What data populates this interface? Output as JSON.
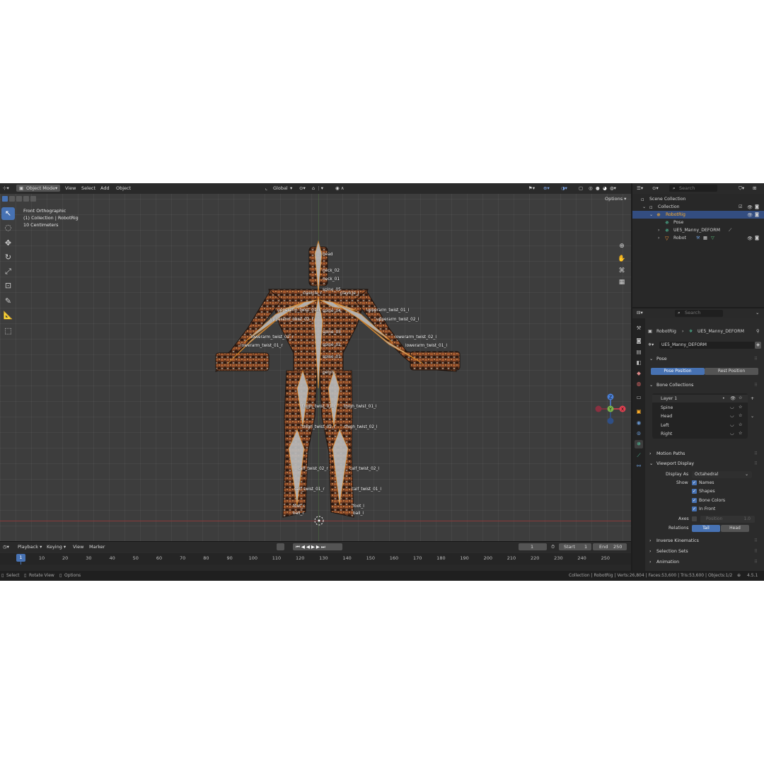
{
  "viewport": {
    "mode": "Object Mode",
    "menus": [
      "View",
      "Select",
      "Add",
      "Object"
    ],
    "transform_orientation": "Global",
    "options_label": "Options",
    "view_name": "Front Orthographic",
    "collection_info": "(1) Collection | RobotRig",
    "scale_info": "10 Centimeters",
    "gizmo_axes": [
      "Z",
      "X",
      "Y"
    ]
  },
  "bones": [
    {
      "name": "head"
    },
    {
      "name": "neck_02"
    },
    {
      "name": "neck_01"
    },
    {
      "name": "spine_05"
    },
    {
      "name": "clavicle_r"
    },
    {
      "name": "clavicle_l"
    },
    {
      "name": "upperarm_twist_01_r"
    },
    {
      "name": "spine_04"
    },
    {
      "name": "upperarm_twist_01_l"
    },
    {
      "name": "upperarm_twist_02_r"
    },
    {
      "name": "upperarm_twist_02_l"
    },
    {
      "name": "spine_03"
    },
    {
      "name": "lowerarm_twist_02_r"
    },
    {
      "name": "lowerarm_twist_02_l"
    },
    {
      "name": "lowerarm_twist_01_r"
    },
    {
      "name": "spine_02"
    },
    {
      "name": "lowerarm_twist_01_l"
    },
    {
      "name": "spine_01"
    },
    {
      "name": "pelvis"
    },
    {
      "name": "thigh_twist_01_r"
    },
    {
      "name": "thigh_twist_01_l"
    },
    {
      "name": "thigh_twist_02_r"
    },
    {
      "name": "thigh_twist_02_l"
    },
    {
      "name": "calf_twist_02_r"
    },
    {
      "name": "calf_twist_02_l"
    },
    {
      "name": "calf_twist_01_r"
    },
    {
      "name": "calf_twist_01_l"
    },
    {
      "name": "foot_r"
    },
    {
      "name": "foot_l"
    },
    {
      "name": "ball_r"
    },
    {
      "name": "ball_l"
    }
  ],
  "timeline": {
    "menus": [
      "Playback",
      "Keying",
      "View",
      "Marker"
    ],
    "current_frame": "1",
    "start_label": "Start",
    "start": "1",
    "end_label": "End",
    "end": "250",
    "ruler": [
      "10",
      "20",
      "30",
      "40",
      "50",
      "60",
      "70",
      "80",
      "90",
      "100",
      "110",
      "120",
      "130",
      "140",
      "150",
      "160",
      "170",
      "180",
      "190",
      "200",
      "210",
      "220",
      "230",
      "240",
      "250"
    ]
  },
  "statusbar": {
    "select": "Select",
    "rotate": "Rotate View",
    "options": "Options",
    "stats": "Collection | RobotRig | Verts:26,804 | Faces:53,600 | Tris:53,600 | Objects:1/2",
    "version": "4.5.1"
  },
  "outliner": {
    "search_placeholder": "Search",
    "scene_collection": "Scene Collection",
    "collection": "Collection",
    "robotrig": "RobotRig",
    "pose": "Pose",
    "armature": "UE5_Manny_DEFORM",
    "robot": "Robot"
  },
  "properties": {
    "search_placeholder": "Search",
    "breadcrumb_object": "RobotRig",
    "breadcrumb_data": "UE5_Manny_DEFORM",
    "data_name": "UE5_Manny_DEFORM",
    "pose_panel": "Pose",
    "pose_position": "Pose Position",
    "rest_position": "Rest Position",
    "bone_collections_panel": "Bone Collections",
    "bone_collections": [
      "Layer 1",
      "Spine",
      "Head",
      "Left",
      "Right"
    ],
    "motion_paths": "Motion Paths",
    "viewport_display": "Viewport Display",
    "display_as_label": "Display As",
    "display_as_value": "Octahedral",
    "show_label": "Show",
    "show_names": "Names",
    "show_shapes": "Shapes",
    "show_bone_colors": "Bone Colors",
    "show_in_front": "In Front",
    "axes_label": "Axes",
    "axes_position": "Position",
    "axes_value": "1.0",
    "relations_label": "Relations",
    "relations_tail": "Tail",
    "relations_head": "Head",
    "inverse_kinematics": "Inverse Kinematics",
    "selection_sets": "Selection Sets",
    "animation": "Animation"
  },
  "colors": {
    "accent": "#4772b3",
    "selection_text": "#ffaf29",
    "viewport_bg": "#3d3d3d",
    "x_axis": "#e04050",
    "y_axis": "#7ab34a",
    "z_axis": "#4a7fd6"
  }
}
